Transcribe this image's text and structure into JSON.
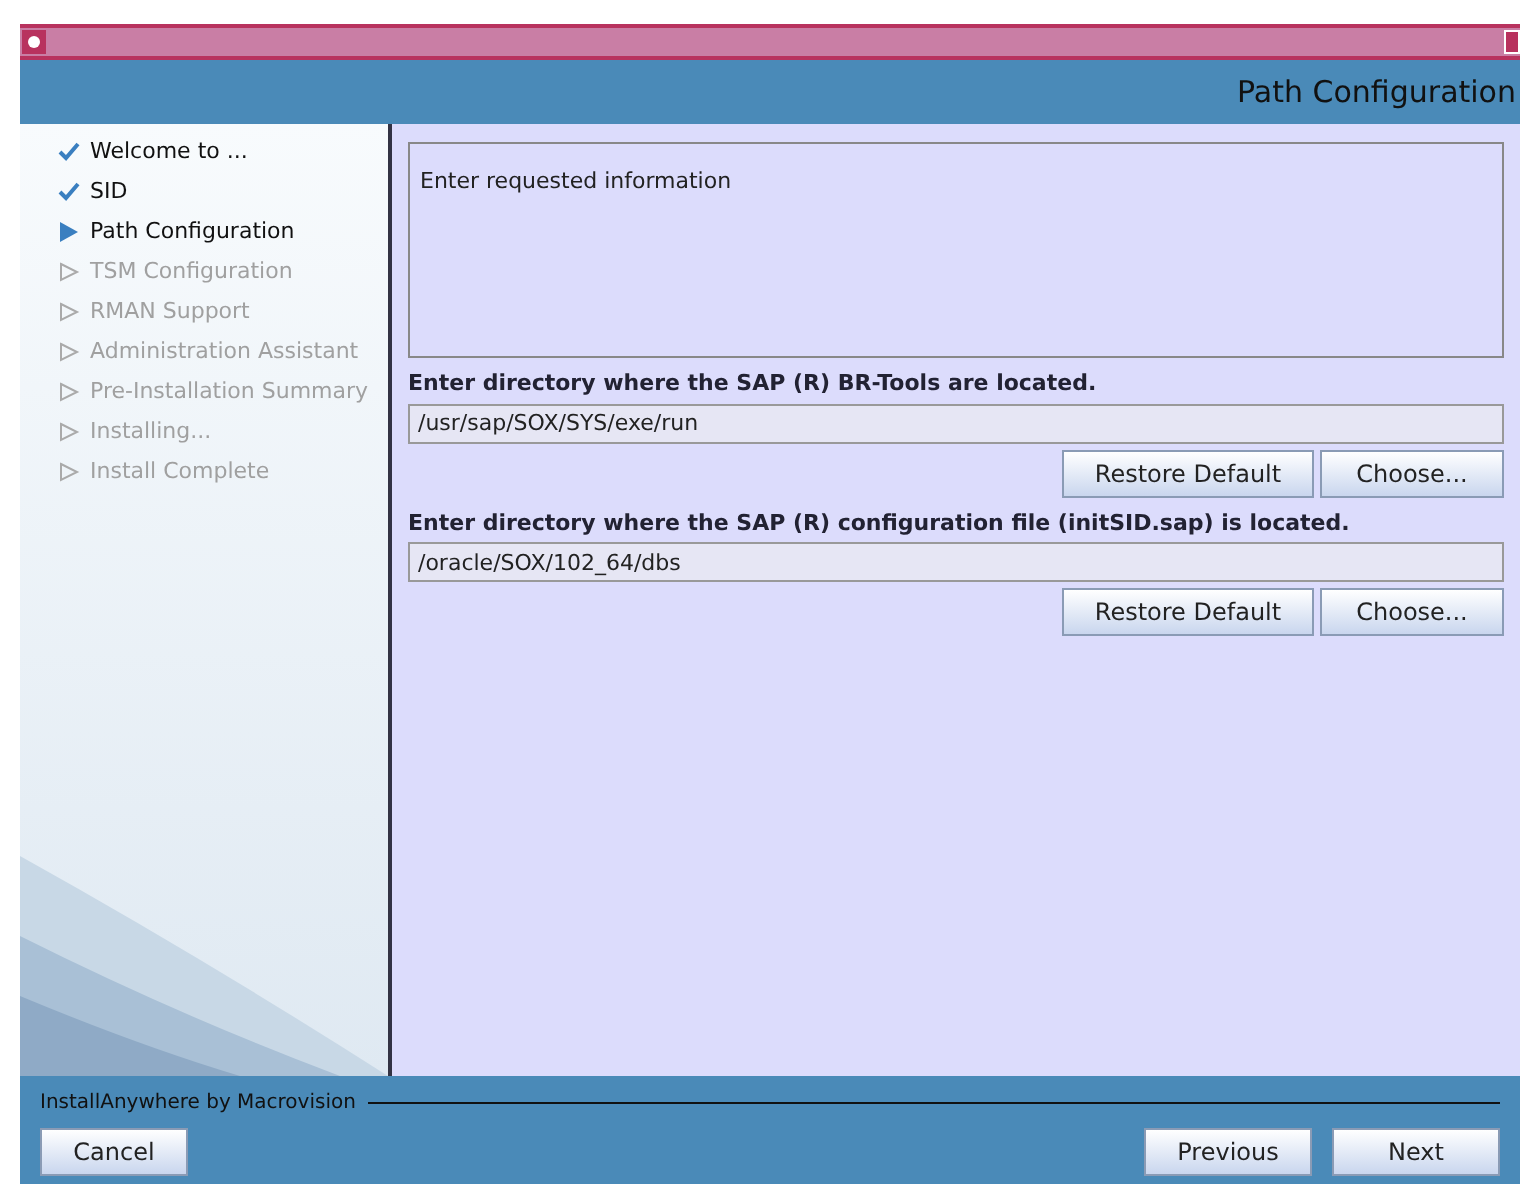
{
  "window": {
    "title": "Path Configuration"
  },
  "steps": [
    {
      "label": "Welcome to ...",
      "kind": "done"
    },
    {
      "label": "SID",
      "kind": "done"
    },
    {
      "label": "Path Configuration",
      "kind": "current"
    },
    {
      "label": "TSM Configuration",
      "kind": "pending"
    },
    {
      "label": "RMAN Support",
      "kind": "pending"
    },
    {
      "label": "Administration Assistant",
      "kind": "pending"
    },
    {
      "label": "Pre-Installation Summary",
      "kind": "pending"
    },
    {
      "label": "Installing...",
      "kind": "pending"
    },
    {
      "label": "Install Complete",
      "kind": "pending"
    }
  ],
  "info": "Enter requested information",
  "fields": [
    {
      "label": "Enter directory where the SAP (R) BR-Tools are located.",
      "value": "/usr/sap/SOX/SYS/exe/run",
      "buttons": [
        "Restore Default",
        "Choose..."
      ]
    },
    {
      "label": "Enter directory where the SAP (R) configuration file (initSID.sap) is located.",
      "value": "/oracle/SOX/102_64/dbs",
      "buttons": [
        "Restore Default",
        "Choose..."
      ]
    }
  ],
  "footer": {
    "brand": "InstallAnywhere by Macrovision",
    "cancel": "Cancel",
    "previous": "Previous",
    "next": "Next"
  }
}
